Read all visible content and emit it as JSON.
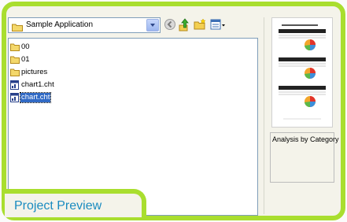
{
  "location": {
    "value": "Sample Application"
  },
  "toolbar": {
    "back_icon": "back-icon",
    "up_icon": "up-folder-icon",
    "new_folder_icon": "new-folder-icon",
    "views_icon": "views-menu-icon"
  },
  "files": [
    {
      "name": "00",
      "type": "folder"
    },
    {
      "name": "01",
      "type": "folder"
    },
    {
      "name": "pictures",
      "type": "folder"
    },
    {
      "name": "chart1.cht",
      "type": "chart"
    },
    {
      "name": "chart.cht",
      "type": "chart",
      "selected": true
    }
  ],
  "preview": {
    "caption": "Analysis by Category"
  },
  "tab": {
    "label": "Project Preview"
  },
  "colors": {
    "accent": "#a9de2f",
    "tab_text": "#1a8bc0",
    "selection": "#316ac5"
  }
}
